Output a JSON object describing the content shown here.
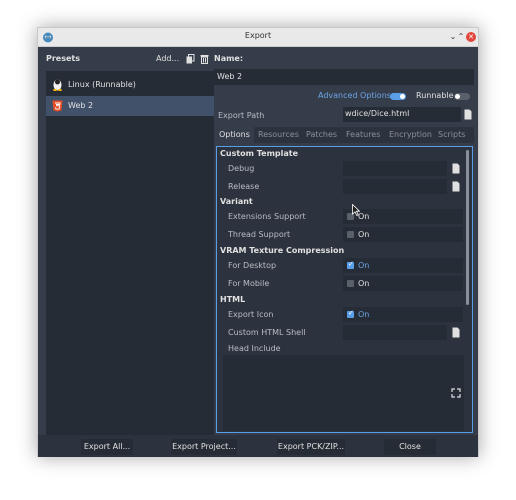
{
  "window": {
    "title": "Export"
  },
  "left": {
    "presets_label": "Presets",
    "add_label": "Add...",
    "presets": [
      {
        "label": "Linux (Runnable)",
        "icon": "linux-tux-icon",
        "selected": false
      },
      {
        "label": "Web 2",
        "icon": "html5-icon",
        "selected": true
      }
    ]
  },
  "right": {
    "name_label": "Name:",
    "name_value": "Web 2",
    "advanced_options_label": "Advanced Options",
    "advanced_options_on": true,
    "runnable_label": "Runnable",
    "runnable_on": false,
    "export_path_label": "Export Path",
    "export_path_value": "wdice/Dice.html",
    "tabs": [
      "Options",
      "Resources",
      "Patches",
      "Features",
      "Encryption",
      "Scripts"
    ],
    "active_tab": "Options",
    "sections": {
      "custom_template": "Custom Template",
      "debug": "Debug",
      "release": "Release",
      "variant": "Variant",
      "extensions_support": "Extensions Support",
      "thread_support": "Thread Support",
      "vram": "VRAM Texture Compression",
      "for_desktop": "For Desktop",
      "for_mobile": "For Mobile",
      "html": "HTML",
      "export_icon": "Export Icon",
      "custom_html_shell": "Custom HTML Shell",
      "head_include": "Head Include"
    },
    "on_text": "On",
    "values": {
      "extensions_support": false,
      "thread_support": false,
      "for_desktop": true,
      "for_mobile": false,
      "export_icon": true
    }
  },
  "footer": {
    "export_all": "Export All...",
    "export_project": "Export Project...",
    "export_pck": "Export PCK/ZIP...",
    "close": "Close"
  },
  "colors": {
    "accent": "#5b9ee8",
    "panel_bg": "#363d4a",
    "field_bg": "#262c36",
    "selected_bg": "#41516a"
  }
}
